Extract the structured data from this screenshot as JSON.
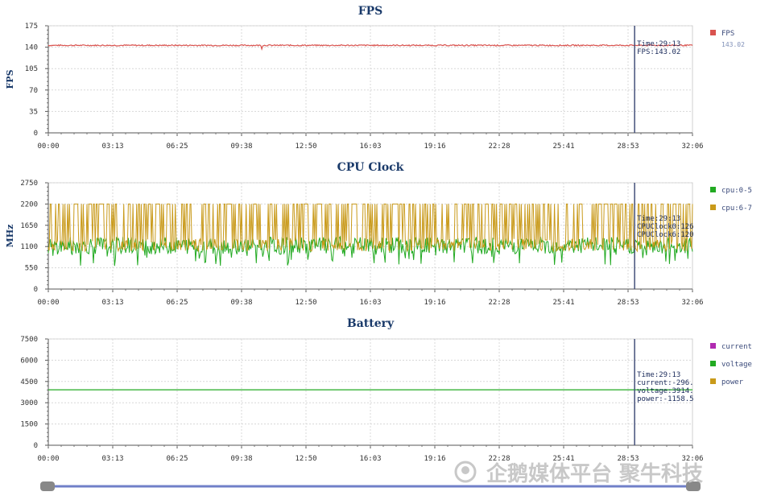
{
  "chart_data": [
    {
      "id": "fps",
      "type": "line",
      "title": "FPS",
      "ylabel": "FPS",
      "ylim": [
        0,
        175
      ],
      "yticks": [
        "175",
        "140",
        "105",
        "70",
        "35",
        "0"
      ],
      "ytick_values": [
        175,
        140,
        105,
        70,
        35,
        0
      ],
      "xticks": [
        "00:00",
        "03:13",
        "06:25",
        "09:38",
        "12:50",
        "16:03",
        "19:16",
        "22:28",
        "25:41",
        "28:53",
        "32:06"
      ],
      "x_range_seconds": [
        0,
        1926
      ],
      "grid": true,
      "series": [
        {
          "name": "FPS",
          "color": "#d9534f",
          "base": 143,
          "noise": 2,
          "legend_value": "143.02"
        }
      ],
      "cursor": {
        "time_seconds": 1753,
        "lines": [
          "Time:29:13",
          "FPS:143.02"
        ]
      }
    },
    {
      "id": "cpu",
      "type": "line",
      "title": "CPU Clock",
      "ylabel": "MHz",
      "ylim": [
        0,
        2750
      ],
      "yticks": [
        "2750",
        "2200",
        "1650",
        "1100",
        "550",
        "0"
      ],
      "ytick_values": [
        2750,
        2200,
        1650,
        1100,
        550,
        0
      ],
      "xticks": [
        "00:00",
        "03:13",
        "06:25",
        "09:38",
        "12:50",
        "16:03",
        "19:16",
        "22:28",
        "25:41",
        "28:53",
        "32:06"
      ],
      "x_range_seconds": [
        0,
        1926
      ],
      "grid": true,
      "series": [
        {
          "name": "cpu:0-5",
          "color": "#22aa22",
          "base": 1100,
          "noise": 250
        },
        {
          "name": "cpu:6-7",
          "color": "#c99a1a",
          "base": 1200,
          "noise": 1000
        }
      ],
      "cursor": {
        "time_seconds": 1753,
        "lines": [
          "Time:29:13",
          "CPUClock0:126",
          "CPUClock6:120"
        ]
      }
    },
    {
      "id": "battery",
      "type": "line",
      "title": "Battery",
      "ylabel": "",
      "ylim": [
        0,
        7500
      ],
      "yticks": [
        "7500",
        "6000",
        "4500",
        "3000",
        "1500",
        "0"
      ],
      "ytick_values": [
        7500,
        6000,
        4500,
        3000,
        1500,
        0
      ],
      "xticks": [
        "00:00",
        "03:13",
        "06:25",
        "09:38",
        "12:50",
        "16:03",
        "19:16",
        "22:28",
        "25:41",
        "28:53",
        "32:06"
      ],
      "x_range_seconds": [
        0,
        1926
      ],
      "grid": true,
      "series": [
        {
          "name": "current",
          "color": "#b02ab0",
          "base": -296,
          "noise": 0
        },
        {
          "name": "voltage",
          "color": "#22aa22",
          "base": 3914,
          "noise": 0
        },
        {
          "name": "power",
          "color": "#c99a1a",
          "base": -1158,
          "noise": 0
        }
      ],
      "cursor": {
        "time_seconds": 1753,
        "lines": [
          "Time:29:13",
          "current:-296.",
          "voltage:3914.",
          "power:-1158.5"
        ]
      }
    }
  ],
  "watermark": "企鹅媒体平台 聚牛科技"
}
